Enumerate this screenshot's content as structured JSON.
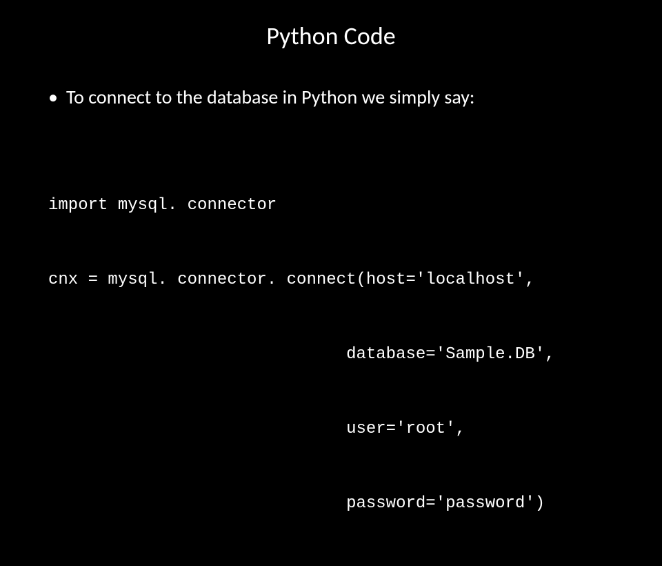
{
  "slide": {
    "title": "Python Code",
    "bullet": "To connect to the database in Python we simply say:",
    "code": {
      "line1": "import mysql. connector",
      "line2": "cnx = mysql. connector. connect(host='localhost',",
      "line3": "                              database='Sample.DB',",
      "line4": "                              user='root',",
      "line5": "                              password='password')"
    }
  }
}
